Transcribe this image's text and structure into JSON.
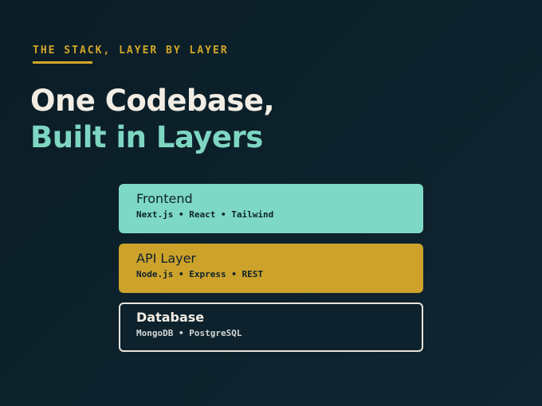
{
  "eyebrow": "THE STACK, LAYER BY LAYER",
  "headline": {
    "line1": "One Codebase,",
    "line2": "Built in Layers"
  },
  "layers": [
    {
      "title": "Frontend",
      "subtitle": "Next.js • React • Tailwind"
    },
    {
      "title": "API Layer",
      "subtitle": "Node.js • Express • REST"
    },
    {
      "title": "Database",
      "subtitle": "MongoDB • PostgreSQL"
    }
  ],
  "colors": {
    "background": "#0d222c",
    "accent_gold": "#d4a62a",
    "accent_teal": "#7ed6c2",
    "text_light": "#f2ede4"
  }
}
